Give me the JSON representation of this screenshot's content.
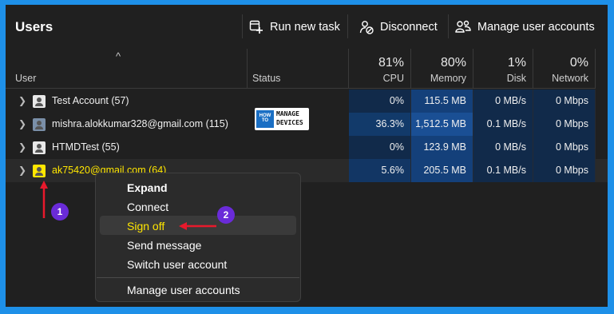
{
  "header": {
    "title": "Users",
    "run_new_task": "Run new task",
    "disconnect": "Disconnect",
    "manage_accounts": "Manage user accounts"
  },
  "columns": {
    "user": "User",
    "status": "Status",
    "cpu": {
      "pct": "81%",
      "label": "CPU"
    },
    "memory": {
      "pct": "80%",
      "label": "Memory"
    },
    "disk": {
      "pct": "1%",
      "label": "Disk"
    },
    "network": {
      "pct": "0%",
      "label": "Network"
    },
    "sort_indicator": "^"
  },
  "rows": [
    {
      "name": "Test Account (57)",
      "cpu": "0%",
      "memory": "115.5 MB",
      "disk": "0 MB/s",
      "network": "0 Mbps"
    },
    {
      "name": "mishra.alokkumar328@gmail.com (115)",
      "cpu": "36.3%",
      "memory": "1,512.5 MB",
      "disk": "0.1 MB/s",
      "network": "0 Mbps"
    },
    {
      "name": "HTMDTest (55)",
      "cpu": "0%",
      "memory": "123.9 MB",
      "disk": "0 MB/s",
      "network": "0 Mbps"
    },
    {
      "name": "ak75420@gmail.com (64)",
      "cpu": "5.6%",
      "memory": "205.5 MB",
      "disk": "0.1 MB/s",
      "network": "0 Mbps"
    }
  ],
  "watermark": {
    "how_to": "HOW TO",
    "manage": "MANAGE",
    "devices": "DEVICES"
  },
  "context_menu": {
    "items": [
      "Expand",
      "Connect",
      "Sign off",
      "Send message",
      "Switch user account",
      "Manage user accounts"
    ]
  },
  "annotations": {
    "badge1": "1",
    "badge2": "2"
  },
  "colors": {
    "accent": "#1e90e8",
    "badge": "#6a2bd9",
    "arrow": "#e8192c",
    "highlight_text": "#ffe600"
  }
}
